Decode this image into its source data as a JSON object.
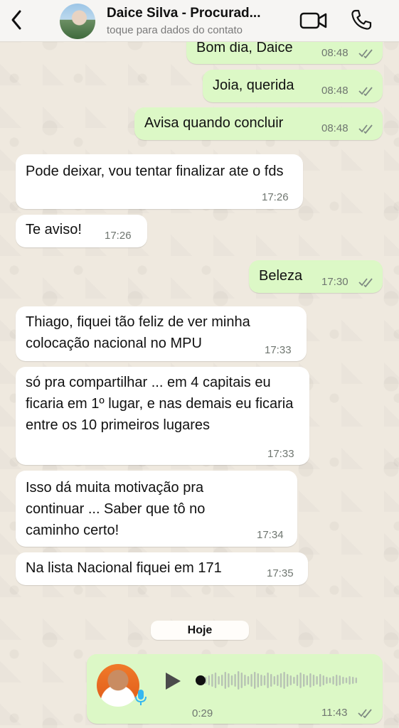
{
  "header": {
    "contact_name": "Daice Silva - Procurad...",
    "subtitle": "toque para dados do contato",
    "back_icon": "chevron-left-icon",
    "video_icon": "video-camera-icon",
    "call_icon": "phone-icon"
  },
  "colors": {
    "outgoing_bubble": "#dcf8c6",
    "incoming_bubble": "#ffffff",
    "background": "#efe9df",
    "read_ticks": "#7f8a83"
  },
  "messages": [
    {
      "dir": "out",
      "text": "Bom dia, Daice",
      "time": "08:48",
      "status": "read"
    },
    {
      "dir": "out",
      "text": "Joia, querida",
      "time": "08:48",
      "status": "read"
    },
    {
      "dir": "out",
      "text": "Avisa quando concluir",
      "time": "08:48",
      "status": "read"
    },
    {
      "dir": "in",
      "text": "Pode deixar, vou tentar finalizar ate o fds",
      "time": "17:26"
    },
    {
      "dir": "in",
      "text": "Te aviso!",
      "time": "17:26"
    },
    {
      "dir": "out",
      "text": "Beleza",
      "time": "17:30",
      "status": "read"
    },
    {
      "dir": "in",
      "text": "Thiago, fiquei tão feliz de ver minha colocação nacional no MPU",
      "time": "17:33"
    },
    {
      "dir": "in",
      "text": "só pra compartilhar ... em 4 capitais eu ficaria em 1º lugar, e nas demais eu ficaria entre os 10 primeiros lugares",
      "time": "17:33"
    },
    {
      "dir": "in",
      "text": "Isso dá muita motivação pra continuar ... Saber que tô no caminho certo!",
      "time": "17:34"
    },
    {
      "dir": "in",
      "text": "Na lista Nacional fiquei em 171",
      "time": "17:35"
    }
  ],
  "day_separator": "Hoje",
  "voice_message": {
    "duration": "0:29",
    "time": "11:43",
    "status": "read",
    "progress": 0
  }
}
